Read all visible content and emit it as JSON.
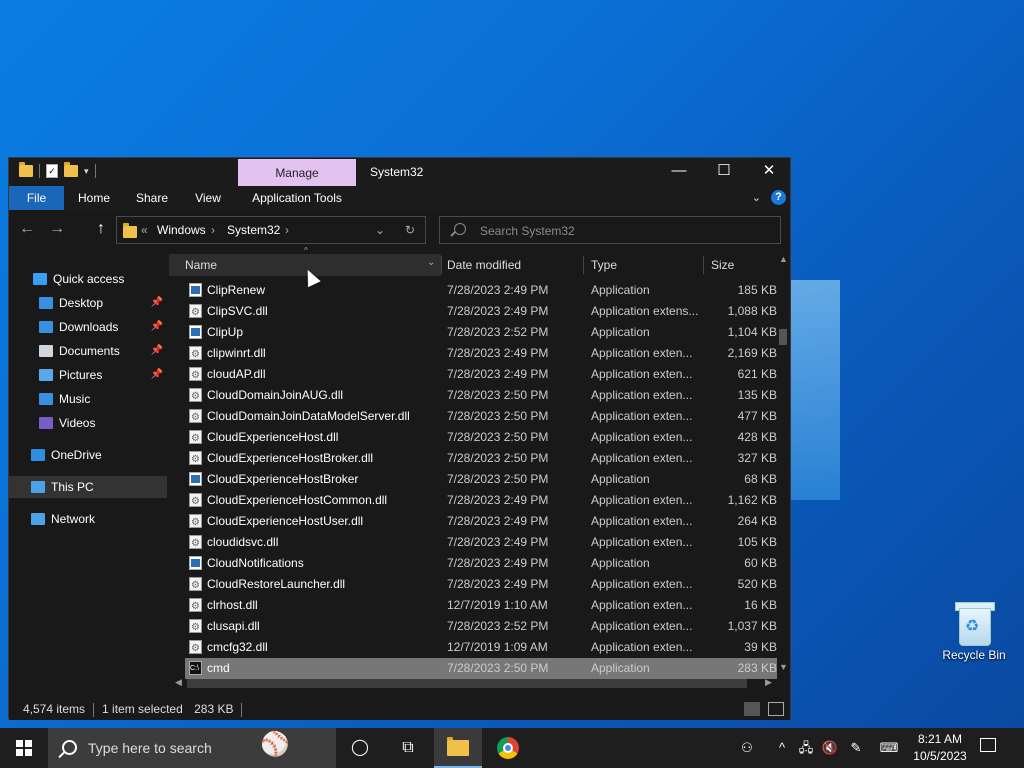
{
  "window": {
    "title": "System32",
    "manage_tab": "Manage",
    "ribbon_tabs": [
      "File",
      "Home",
      "Share",
      "View",
      "Application Tools"
    ],
    "address": {
      "prefix": "«",
      "crumbs": [
        "Windows",
        "System32"
      ]
    },
    "search_placeholder": "Search System32"
  },
  "nav": [
    {
      "label": "Quick access",
      "icon": "star-icon",
      "color": "#3b9ef0"
    },
    {
      "label": "Desktop",
      "icon": "desktop-icon",
      "color": "#3b8fe0",
      "pinned": true
    },
    {
      "label": "Downloads",
      "icon": "downloads-icon",
      "color": "#3b8fe0",
      "pinned": true
    },
    {
      "label": "Documents",
      "icon": "documents-icon",
      "color": "#cfd6de",
      "pinned": true
    },
    {
      "label": "Pictures",
      "icon": "pictures-icon",
      "color": "#5aa8e8",
      "pinned": true
    },
    {
      "label": "Music",
      "icon": "music-icon",
      "color": "#3b8fe0"
    },
    {
      "label": "Videos",
      "icon": "videos-icon",
      "color": "#7a5cc7"
    },
    {
      "label": "OneDrive",
      "icon": "onedrive-icon",
      "color": "#2f8ee0"
    },
    {
      "label": "This PC",
      "icon": "this-pc-icon",
      "color": "#4aa3e8"
    },
    {
      "label": "Network",
      "icon": "network-icon",
      "color": "#4aa3e8"
    }
  ],
  "columns": {
    "name": "Name",
    "date": "Date modified",
    "type": "Type",
    "size": "Size"
  },
  "files": [
    {
      "name": "ClipRenew",
      "date": "7/28/2023 2:49 PM",
      "type": "Application",
      "size": "185 KB",
      "icon": "app"
    },
    {
      "name": "ClipSVC.dll",
      "date": "7/28/2023 2:49 PM",
      "type": "Application extens...",
      "size": "1,088 KB",
      "icon": "dll"
    },
    {
      "name": "ClipUp",
      "date": "7/28/2023 2:52 PM",
      "type": "Application",
      "size": "1,104 KB",
      "icon": "app"
    },
    {
      "name": "clipwinrt.dll",
      "date": "7/28/2023 2:49 PM",
      "type": "Application exten...",
      "size": "2,169 KB",
      "icon": "dll"
    },
    {
      "name": "cloudAP.dll",
      "date": "7/28/2023 2:49 PM",
      "type": "Application exten...",
      "size": "621 KB",
      "icon": "dll"
    },
    {
      "name": "CloudDomainJoinAUG.dll",
      "date": "7/28/2023 2:50 PM",
      "type": "Application exten...",
      "size": "135 KB",
      "icon": "dll"
    },
    {
      "name": "CloudDomainJoinDataModelServer.dll",
      "date": "7/28/2023 2:50 PM",
      "type": "Application exten...",
      "size": "477 KB",
      "icon": "dll"
    },
    {
      "name": "CloudExperienceHost.dll",
      "date": "7/28/2023 2:50 PM",
      "type": "Application exten...",
      "size": "428 KB",
      "icon": "dll"
    },
    {
      "name": "CloudExperienceHostBroker.dll",
      "date": "7/28/2023 2:50 PM",
      "type": "Application exten...",
      "size": "327 KB",
      "icon": "dll"
    },
    {
      "name": "CloudExperienceHostBroker",
      "date": "7/28/2023 2:50 PM",
      "type": "Application",
      "size": "68 KB",
      "icon": "app"
    },
    {
      "name": "CloudExperienceHostCommon.dll",
      "date": "7/28/2023 2:49 PM",
      "type": "Application exten...",
      "size": "1,162 KB",
      "icon": "dll"
    },
    {
      "name": "CloudExperienceHostUser.dll",
      "date": "7/28/2023 2:49 PM",
      "type": "Application exten...",
      "size": "264 KB",
      "icon": "dll"
    },
    {
      "name": "cloudidsvc.dll",
      "date": "7/28/2023 2:49 PM",
      "type": "Application exten...",
      "size": "105 KB",
      "icon": "dll"
    },
    {
      "name": "CloudNotifications",
      "date": "7/28/2023 2:49 PM",
      "type": "Application",
      "size": "60 KB",
      "icon": "app"
    },
    {
      "name": "CloudRestoreLauncher.dll",
      "date": "7/28/2023 2:49 PM",
      "type": "Application exten...",
      "size": "520 KB",
      "icon": "dll"
    },
    {
      "name": "clrhost.dll",
      "date": "12/7/2019 1:10 AM",
      "type": "Application exten...",
      "size": "16 KB",
      "icon": "dll"
    },
    {
      "name": "clusapi.dll",
      "date": "7/28/2023 2:52 PM",
      "type": "Application exten...",
      "size": "1,037 KB",
      "icon": "dll"
    },
    {
      "name": "cmcfg32.dll",
      "date": "12/7/2019 1:09 AM",
      "type": "Application exten...",
      "size": "39 KB",
      "icon": "dll"
    },
    {
      "name": "cmd",
      "date": "7/28/2023 2:50 PM",
      "type": "Application",
      "size": "283 KB",
      "icon": "cmd",
      "selected": true
    }
  ],
  "status": {
    "items": "4,574 items",
    "selected": "1 item selected",
    "size": "283 KB"
  },
  "desktop": {
    "recycle_bin": "Recycle Bin"
  },
  "taskbar": {
    "search_placeholder": "Type here to search",
    "time": "8:21 AM",
    "date": "10/5/2023"
  }
}
